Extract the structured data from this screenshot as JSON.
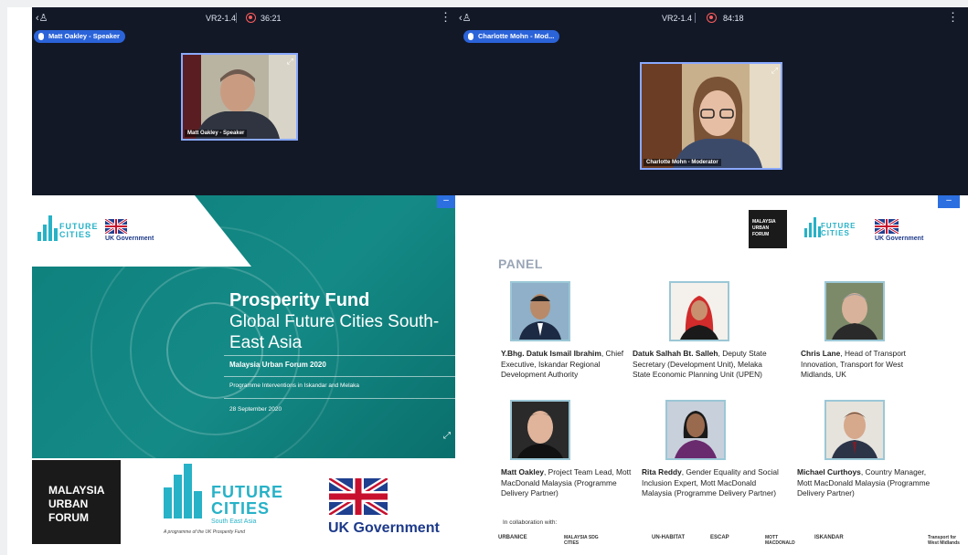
{
  "left_pane": {
    "room": "VR2-1.4",
    "timer": "36:21",
    "speaker_pill": "Matt Oakley - Speaker",
    "video_caption": "Matt Oakley - Speaker"
  },
  "right_pane": {
    "room": "VR2-1.4",
    "timer": "84:18",
    "speaker_pill": "Charlotte Mohn - Mod...",
    "video_caption": "Charlotte Mohn - Moderator"
  },
  "left_slide": {
    "fc_word": "FUTURE CITIES",
    "fc_sub": "South East Asia",
    "uk_text": "UK Government",
    "title": "Prosperity Fund",
    "subtitle": "Global Future Cities South-East Asia",
    "forum": "Malaysia Urban Forum 2020",
    "programme": "Programme Interventions in Iskandar and Melaka",
    "date": "28 September 2020",
    "min_label": "–"
  },
  "bottom_logos": {
    "muf_lines": [
      "MALAYSIA",
      "URBAN",
      "FORUM"
    ],
    "fc_word": "FUTURE CITIES",
    "fc_sub": "South East Asia",
    "fc_tag": "A programme of the UK Prosperity Fund",
    "uk_text": "UK Government"
  },
  "panel": {
    "muf_small": "MALAYSIA URBAN FORUM",
    "fc_word": "FUTURE CITIES",
    "uk_text": "UK Government",
    "title": "PANEL",
    "min_label": "–",
    "members": [
      {
        "name": "Y.Bhg. Datuk Ismail Ibrahim",
        "role": ", Chief Executive, Iskandar Regional Development Authority"
      },
      {
        "name": "Datuk Salhah Bt. Salleh",
        "role": ", Deputy State Secretary (Development Unit), Melaka State Economic Planning Unit (UPEN)"
      },
      {
        "name": "Chris Lane",
        "role": ", Head of Transport Innovation, Transport for West Midlands, UK"
      },
      {
        "name": "Matt Oakley",
        "role": ", Project Team Lead, Mott MacDonald Malaysia (Programme Delivery Partner)"
      },
      {
        "name": "Rita Reddy",
        "role": ", Gender Equality and Social Inclusion Expert, Mott MacDonald Malaysia (Programme Delivery Partner)"
      },
      {
        "name": "Michael Curthoys",
        "role": ", Country Manager, Mott MacDonald Malaysia (Programme Delivery Partner)"
      }
    ],
    "collab_label": "In collaboration with:",
    "partners": [
      "URBANICE",
      "MALAYSIA SDG CITIES",
      "UN-HABITAT",
      "ESCAP",
      "MOTT MACDONALD",
      "ISKANDAR",
      "Transport for West Midlands"
    ]
  },
  "colors": {
    "teal": "#148a86",
    "accent_blue": "#2b63d9",
    "fc_cyan": "#27b2c7",
    "uk_navy": "#1d3a8a"
  }
}
